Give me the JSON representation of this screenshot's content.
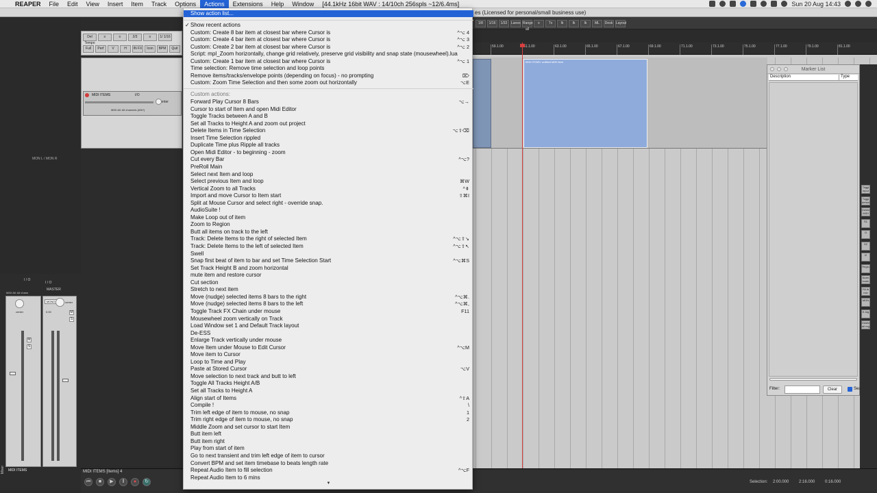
{
  "menubar": {
    "apple_glyph": "",
    "app_name": "REAPER",
    "items": [
      "File",
      "Edit",
      "View",
      "Insert",
      "Item",
      "Track",
      "Options",
      "Actions",
      "Extensions",
      "Help",
      "Window"
    ],
    "active_item": "Actions",
    "status": "[44.1kHz 16bit WAV : 14/10ch 256spls ~12/6.4ms]",
    "clock": "Sun 20 Aug  14:43"
  },
  "window": {
    "license_text": "es (Licensed for personal/small business use)"
  },
  "toolbar_left": {
    "row1": [
      "Del Tempo",
      "≡",
      "≡",
      "2/3",
      "≡",
      "1/ 1/16"
    ],
    "row2": [
      "Full",
      "Perf",
      "V",
      "H",
      "IN FX",
      "Icon",
      "BPM",
      "Quit"
    ]
  },
  "toolbar_right": [
    "1/8",
    "1/16",
    "1/32",
    "Lanes",
    "Range all",
    "≡",
    "Tx",
    "Ik",
    "Ik",
    "Ik",
    "ML",
    "Desk",
    "Layout"
  ],
  "ruler": {
    "ticks": [
      "59.1.00",
      "61.1.00",
      "63.1.00",
      "65.1.00",
      "67.1.00",
      "69.1.00",
      "71.1.00",
      "73.1.00",
      "75.1.00",
      "77.1.00",
      "79.1.00",
      "81.1.00"
    ]
  },
  "tcp": {
    "track_name": "MIDI ITEMS",
    "master_label": "I/O",
    "route_label": "center",
    "fx_label": "MIDI All: All channels (ANY)",
    "mcp_label": "MON L / MON R"
  },
  "item": {
    "label": "MIDI ITEMS: untitled MIDI item"
  },
  "marker_list": {
    "title": "Marker List",
    "columns": [
      "Description",
      "Type"
    ],
    "filter_label": "Filter:",
    "filter_value": "",
    "clear_label": "Clear",
    "checkbox_label": "Sea"
  },
  "right_strip": [
    "Toggl input",
    "Toggl defaul",
    "Delete MIDI",
    "S1",
    "I1",
    "S2",
    "I2",
    "Regio",
    "Norm loudn",
    "Fill th min",
    "MON",
    "E-Ing",
    "Delete all reg"
  ],
  "mixer": {
    "master_label": "MASTER",
    "io_label": "I / O",
    "center_label": "center",
    "mono_label": "MONO",
    "track_label": "MIDI ITEMS",
    "midi_label": "MIDI All: All chann",
    "db_readout": "0.00",
    "mixer_tab": "Mixer"
  },
  "bottom": {
    "track_info": "MIDI ITEMS [Items] 4",
    "selection_label": "Selection:",
    "sel_start": "2:00.000",
    "sel_end": "2:16.000",
    "sel_len": "0:16.000"
  },
  "actions_menu": {
    "show_action_list": "Show action list...",
    "recent_header": "Show recent actions",
    "recent_checked": true,
    "recent": [
      {
        "label": "Custom: Create 8 bar item at closest bar where Cursor is",
        "shortcut": "^⌥ 4"
      },
      {
        "label": "Custom: Create 4 bar item at closest bar where Cursor is",
        "shortcut": "^⌥ 3"
      },
      {
        "label": "Custom: Create 2 bar item at closest bar where Cursor is",
        "shortcut": "^⌥ 2"
      },
      {
        "label": "Script: mpl_Zoom horizontally, change grid relatively, preserve grid visibility and snap state  (mousewheel).lua",
        "shortcut": ""
      },
      {
        "label": "Custom: Create 1 bar item at closest bar where Cursor is",
        "shortcut": "^⌥ 1"
      },
      {
        "label": "Time selection: Remove time selection and loop points",
        "shortcut": ""
      },
      {
        "label": "Remove items/tracks/envelope points (depending on focus) - no prompting",
        "shortcut": "⌦"
      },
      {
        "label": "Custom: Zoom Time Selection and then some zoom out horizontally",
        "shortcut": "⌥E"
      }
    ],
    "custom_header": "Custom actions:",
    "custom": [
      {
        "label": "Forward Play Cursor 8 Bars",
        "shortcut": "⌥→"
      },
      {
        "label": "Cursor to start of Item and open Midi Editor",
        "shortcut": ""
      },
      {
        "label": "Toggle Tracks between A and B",
        "shortcut": ""
      },
      {
        "label": "Set all Tracks to Height A and zoom out project",
        "shortcut": ""
      },
      {
        "label": "Delete Items in Time Selection",
        "shortcut": "⌥⇧⌫"
      },
      {
        "label": "Insert Time Selection rippled",
        "shortcut": ""
      },
      {
        "label": "Duplicate Time plus Ripple all tracks",
        "shortcut": ""
      },
      {
        "label": "Open Midi Editor - to beginning - zoom",
        "shortcut": ""
      },
      {
        "label": "Cut every Bar",
        "shortcut": "^⌥?"
      },
      {
        "label": "PreRoll Main",
        "shortcut": ""
      },
      {
        "label": "Select next Item and loop",
        "shortcut": ""
      },
      {
        "label": "Select previous Item and loop",
        "shortcut": "⌘W"
      },
      {
        "label": "Vertical Zoom to all Tracks",
        "shortcut": "^⇞"
      },
      {
        "label": "Import and move Cursor to Item start",
        "shortcut": "⇧⌘I"
      },
      {
        "label": "Split at Mouse Cursor and select right - override snap.",
        "shortcut": ""
      },
      {
        "label": "AudioSuite !",
        "shortcut": ""
      },
      {
        "label": "Make Loop out of item",
        "shortcut": ""
      },
      {
        "label": "Zoom to Region",
        "shortcut": ""
      },
      {
        "label": "Butt all items on track to the left",
        "shortcut": ""
      },
      {
        "label": "Track: Delete Items to the right of selected Item",
        "shortcut": "^⌥⇧↘"
      },
      {
        "label": "Track: Delete Items to the left of selected Item",
        "shortcut": "^⌥⇧↖"
      },
      {
        "label": "Swell",
        "shortcut": ""
      },
      {
        "label": "Snap first beat of item to bar and set Time Selection Start",
        "shortcut": "^⌥⌘S"
      },
      {
        "label": "Set Track Height B and zoom horizontal",
        "shortcut": ""
      },
      {
        "label": "mute item and restore cursor",
        "shortcut": ""
      },
      {
        "label": "Cut section",
        "shortcut": ""
      },
      {
        "label": "Stretch to next item",
        "shortcut": ""
      },
      {
        "label": "Move (nudge) selected items 8 bars to the right",
        "shortcut": "^⌥⌘."
      },
      {
        "label": "Move (nudge) selected items 8 bars to the left",
        "shortcut": "^⌥⌘,"
      },
      {
        "label": "Toggle Track FX Chain under mouse",
        "shortcut": "F11"
      },
      {
        "label": "Mousewheel zoom vertically on Track",
        "shortcut": ""
      },
      {
        "label": "Load Window set 1 and Default Track layout",
        "shortcut": ""
      },
      {
        "label": "De-ESS",
        "shortcut": ""
      },
      {
        "label": "Enlarge Track vertically under mouse",
        "shortcut": ""
      },
      {
        "label": "Move Item under Mouse to Edit Cursor",
        "shortcut": "^⌥M"
      },
      {
        "label": "Move item to Cursor",
        "shortcut": ""
      },
      {
        "label": "Loop to Time and Play",
        "shortcut": ""
      },
      {
        "label": "Paste at Stored Cursor",
        "shortcut": "⌥V"
      },
      {
        "label": "Move selection to next track and butt to left",
        "shortcut": ""
      },
      {
        "label": "Toggle All Tracks Height A/B",
        "shortcut": ""
      },
      {
        "label": "Set all Tracks to Height A",
        "shortcut": ""
      },
      {
        "label": "Align start of Items",
        "shortcut": "^⇧A"
      },
      {
        "label": "Compile !",
        "shortcut": "\\"
      },
      {
        "label": "Trim left edge of item to mouse, no snap",
        "shortcut": "1"
      },
      {
        "label": "Trim right edge of item to mouse, no snap",
        "shortcut": "2"
      },
      {
        "label": "Middle Zoom and set cursor to start Item",
        "shortcut": ""
      },
      {
        "label": "Butt item left",
        "shortcut": ""
      },
      {
        "label": "Butt item right",
        "shortcut": ""
      },
      {
        "label": "Play from start of item",
        "shortcut": ""
      },
      {
        "label": "Go to next transient and trim left edge of item to cursor",
        "shortcut": ""
      },
      {
        "label": "Convert BPM and set item timebase to beats length rate",
        "shortcut": ""
      },
      {
        "label": "Repeat Audio Item to fill selection",
        "shortcut": "^⌥F"
      },
      {
        "label": "Repeat Audio Item to 6 mins",
        "shortcut": ""
      }
    ],
    "more_indicator": "▼"
  },
  "colors": {
    "menu_highlight": "#2463d6",
    "menu_bg": "#ededed",
    "item_blue": "#8fabdc",
    "cursor_red": "#d64040"
  }
}
